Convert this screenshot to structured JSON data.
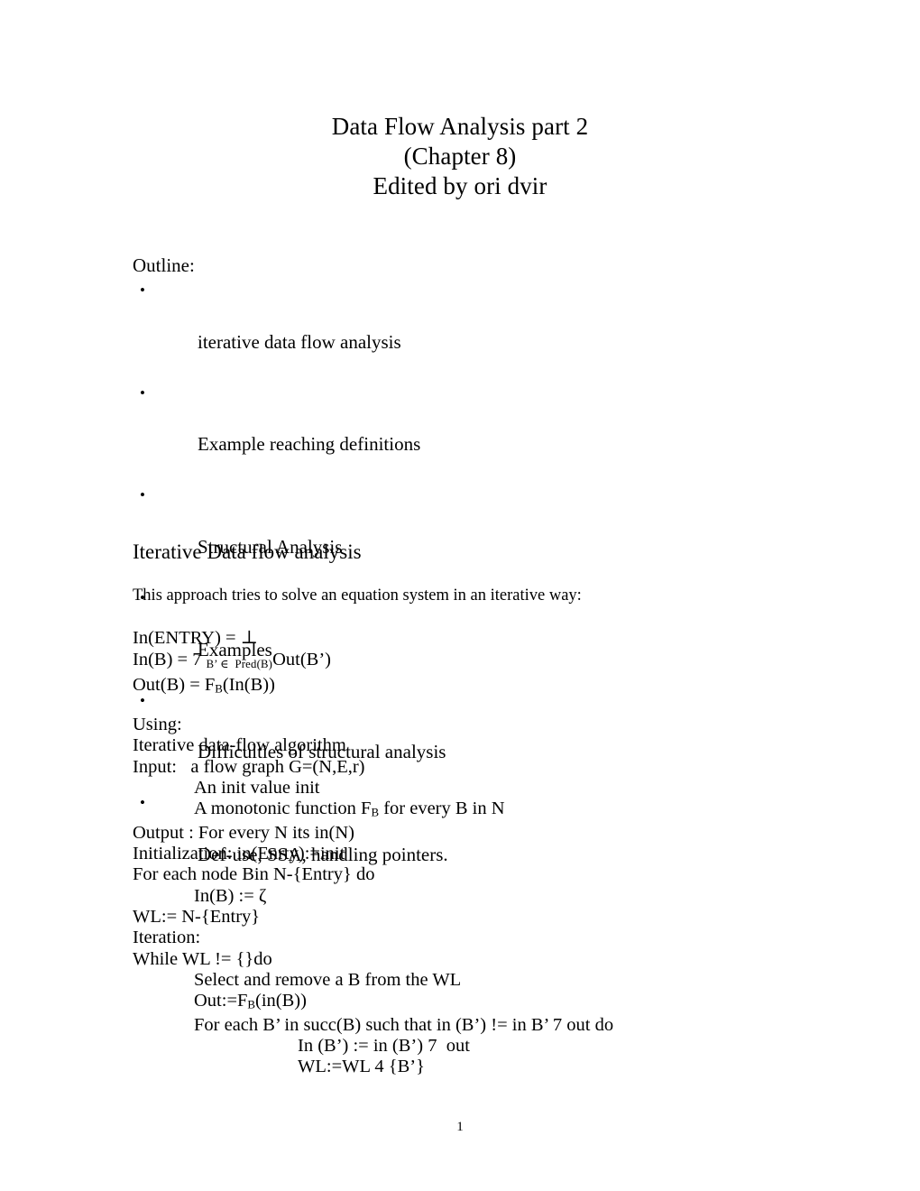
{
  "document": {
    "title_lines": [
      "Data Flow Analysis part 2",
      "(Chapter 8)",
      "Edited by ori dvir"
    ],
    "page_number": "1"
  },
  "outline": {
    "heading": "Outline:",
    "bullet_glyph": "•",
    "items": [
      "iterative data flow analysis",
      "Example reaching definitions",
      "Structural Analysis",
      "Examples",
      "Difficulties of structural analysis",
      "Def-use, SSA, handling pointers."
    ]
  },
  "section": {
    "heading": "Iterative Data flow analysis",
    "lead_paragraph": "This approach tries to solve an equation system in an iterative way:"
  },
  "equations": {
    "line1": "In(ENTRY) = ⊥",
    "line2_pre": "In(B) = 7 ",
    "line2_sub": "B’ ∈  Pred(B)",
    "line2_post": "Out(B’)",
    "line3_pre": "Out(B) = F",
    "line3_sub": "B",
    "line3_post": "(In(B))"
  },
  "algorithm": {
    "using_label": "Using:",
    "name": "Iterative data-flow algorithm",
    "input_line": "Input:   a flow graph G=(N,E,r)",
    "input_init": "An init value init",
    "input_fn_pre": "A monotonic function F",
    "input_fn_sub": "B",
    "input_fn_post": " for every B in N",
    "output_line": "Output : For every N its in(N)",
    "initialization_line": "Initialization: in(Enrty):=init",
    "foreach_node_line": "For each node Bin N-{Entry} do",
    "in_b_assign": "In(B) := ζ",
    "wl_init": "WL:= N-{Entry}",
    "iteration_label": "Iteration:",
    "while_line": "While WL != {}do",
    "select_line": "Select and remove a B from the WL",
    "out_assign_pre": "Out:=F",
    "out_assign_sub": "B",
    "out_assign_post": "(in(B))",
    "foreach_succ_line": "For each B’ in succ(B) such that in (B’) != in B’ 7 out do",
    "in_bprime_assign": "In (B’) := in (B’) 7  out",
    "wl_update": "WL:=WL 4 {B’}"
  }
}
